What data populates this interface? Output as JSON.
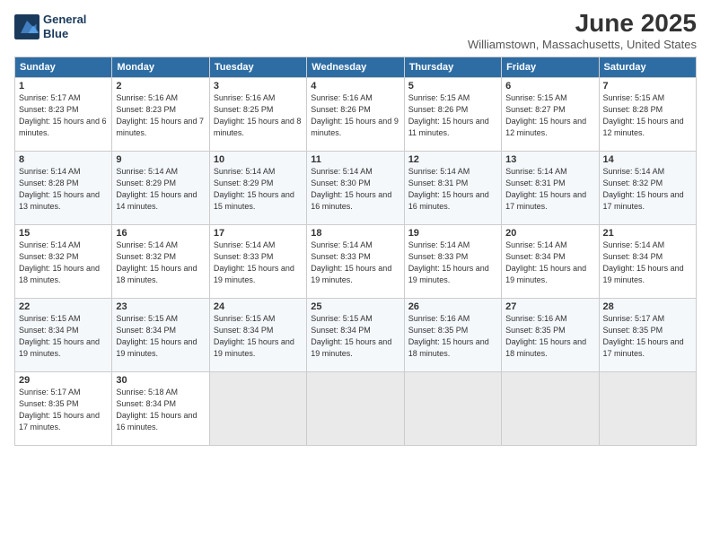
{
  "logo": {
    "line1": "General",
    "line2": "Blue"
  },
  "title": "June 2025",
  "location": "Williamstown, Massachusetts, United States",
  "headers": [
    "Sunday",
    "Monday",
    "Tuesday",
    "Wednesday",
    "Thursday",
    "Friday",
    "Saturday"
  ],
  "weeks": [
    [
      {
        "day": "1",
        "sunrise": "Sunrise: 5:17 AM",
        "sunset": "Sunset: 8:23 PM",
        "daylight": "Daylight: 15 hours and 6 minutes."
      },
      {
        "day": "2",
        "sunrise": "Sunrise: 5:16 AM",
        "sunset": "Sunset: 8:23 PM",
        "daylight": "Daylight: 15 hours and 7 minutes."
      },
      {
        "day": "3",
        "sunrise": "Sunrise: 5:16 AM",
        "sunset": "Sunset: 8:25 PM",
        "daylight": "Daylight: 15 hours and 8 minutes."
      },
      {
        "day": "4",
        "sunrise": "Sunrise: 5:16 AM",
        "sunset": "Sunset: 8:26 PM",
        "daylight": "Daylight: 15 hours and 9 minutes."
      },
      {
        "day": "5",
        "sunrise": "Sunrise: 5:15 AM",
        "sunset": "Sunset: 8:26 PM",
        "daylight": "Daylight: 15 hours and 11 minutes."
      },
      {
        "day": "6",
        "sunrise": "Sunrise: 5:15 AM",
        "sunset": "Sunset: 8:27 PM",
        "daylight": "Daylight: 15 hours and 12 minutes."
      },
      {
        "day": "7",
        "sunrise": "Sunrise: 5:15 AM",
        "sunset": "Sunset: 8:28 PM",
        "daylight": "Daylight: 15 hours and 12 minutes."
      }
    ],
    [
      {
        "day": "8",
        "sunrise": "Sunrise: 5:14 AM",
        "sunset": "Sunset: 8:28 PM",
        "daylight": "Daylight: 15 hours and 13 minutes."
      },
      {
        "day": "9",
        "sunrise": "Sunrise: 5:14 AM",
        "sunset": "Sunset: 8:29 PM",
        "daylight": "Daylight: 15 hours and 14 minutes."
      },
      {
        "day": "10",
        "sunrise": "Sunrise: 5:14 AM",
        "sunset": "Sunset: 8:29 PM",
        "daylight": "Daylight: 15 hours and 15 minutes."
      },
      {
        "day": "11",
        "sunrise": "Sunrise: 5:14 AM",
        "sunset": "Sunset: 8:30 PM",
        "daylight": "Daylight: 15 hours and 16 minutes."
      },
      {
        "day": "12",
        "sunrise": "Sunrise: 5:14 AM",
        "sunset": "Sunset: 8:31 PM",
        "daylight": "Daylight: 15 hours and 16 minutes."
      },
      {
        "day": "13",
        "sunrise": "Sunrise: 5:14 AM",
        "sunset": "Sunset: 8:31 PM",
        "daylight": "Daylight: 15 hours and 17 minutes."
      },
      {
        "day": "14",
        "sunrise": "Sunrise: 5:14 AM",
        "sunset": "Sunset: 8:32 PM",
        "daylight": "Daylight: 15 hours and 17 minutes."
      }
    ],
    [
      {
        "day": "15",
        "sunrise": "Sunrise: 5:14 AM",
        "sunset": "Sunset: 8:32 PM",
        "daylight": "Daylight: 15 hours and 18 minutes."
      },
      {
        "day": "16",
        "sunrise": "Sunrise: 5:14 AM",
        "sunset": "Sunset: 8:32 PM",
        "daylight": "Daylight: 15 hours and 18 minutes."
      },
      {
        "day": "17",
        "sunrise": "Sunrise: 5:14 AM",
        "sunset": "Sunset: 8:33 PM",
        "daylight": "Daylight: 15 hours and 19 minutes."
      },
      {
        "day": "18",
        "sunrise": "Sunrise: 5:14 AM",
        "sunset": "Sunset: 8:33 PM",
        "daylight": "Daylight: 15 hours and 19 minutes."
      },
      {
        "day": "19",
        "sunrise": "Sunrise: 5:14 AM",
        "sunset": "Sunset: 8:33 PM",
        "daylight": "Daylight: 15 hours and 19 minutes."
      },
      {
        "day": "20",
        "sunrise": "Sunrise: 5:14 AM",
        "sunset": "Sunset: 8:34 PM",
        "daylight": "Daylight: 15 hours and 19 minutes."
      },
      {
        "day": "21",
        "sunrise": "Sunrise: 5:14 AM",
        "sunset": "Sunset: 8:34 PM",
        "daylight": "Daylight: 15 hours and 19 minutes."
      }
    ],
    [
      {
        "day": "22",
        "sunrise": "Sunrise: 5:15 AM",
        "sunset": "Sunset: 8:34 PM",
        "daylight": "Daylight: 15 hours and 19 minutes."
      },
      {
        "day": "23",
        "sunrise": "Sunrise: 5:15 AM",
        "sunset": "Sunset: 8:34 PM",
        "daylight": "Daylight: 15 hours and 19 minutes."
      },
      {
        "day": "24",
        "sunrise": "Sunrise: 5:15 AM",
        "sunset": "Sunset: 8:34 PM",
        "daylight": "Daylight: 15 hours and 19 minutes."
      },
      {
        "day": "25",
        "sunrise": "Sunrise: 5:15 AM",
        "sunset": "Sunset: 8:34 PM",
        "daylight": "Daylight: 15 hours and 19 minutes."
      },
      {
        "day": "26",
        "sunrise": "Sunrise: 5:16 AM",
        "sunset": "Sunset: 8:35 PM",
        "daylight": "Daylight: 15 hours and 18 minutes."
      },
      {
        "day": "27",
        "sunrise": "Sunrise: 5:16 AM",
        "sunset": "Sunset: 8:35 PM",
        "daylight": "Daylight: 15 hours and 18 minutes."
      },
      {
        "day": "28",
        "sunrise": "Sunrise: 5:17 AM",
        "sunset": "Sunset: 8:35 PM",
        "daylight": "Daylight: 15 hours and 17 minutes."
      }
    ],
    [
      {
        "day": "29",
        "sunrise": "Sunrise: 5:17 AM",
        "sunset": "Sunset: 8:35 PM",
        "daylight": "Daylight: 15 hours and 17 minutes."
      },
      {
        "day": "30",
        "sunrise": "Sunrise: 5:18 AM",
        "sunset": "Sunset: 8:34 PM",
        "daylight": "Daylight: 15 hours and 16 minutes."
      },
      null,
      null,
      null,
      null,
      null
    ]
  ]
}
